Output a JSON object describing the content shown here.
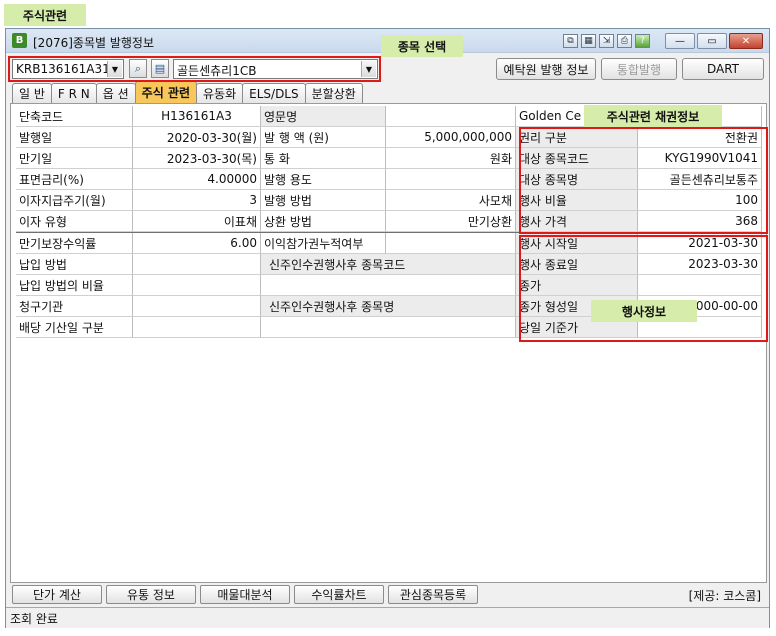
{
  "annotations": {
    "top_label": "주식관련",
    "stock_select": "종목 선택",
    "bond_info": "주식관련 채권정보",
    "exercise_info": "행사정보"
  },
  "window": {
    "title": "[2076]종목별 발행정보",
    "icon_letter": "B"
  },
  "toolbar": {
    "code_value": "KRB136161A31",
    "name_value": "골든센츄리1CB",
    "depository_button": "예탁원 발행 정보",
    "integrated_button": "통합발행",
    "dart_button": "DART"
  },
  "tabs": [
    {
      "label": "일  반"
    },
    {
      "label": "F R N"
    },
    {
      "label": "옵  션"
    },
    {
      "label": "주식 관련"
    },
    {
      "label": "유동화"
    },
    {
      "label": "ELS/DLS"
    },
    {
      "label": "분할상환"
    }
  ],
  "left_table": [
    {
      "label": "단축코드",
      "value": "H136161A3"
    },
    {
      "label": "발행일",
      "value": "2020-03-30(월)"
    },
    {
      "label": "만기일",
      "value": "2023-03-30(목)"
    },
    {
      "label": "표면금리(%)",
      "value": "4.00000"
    },
    {
      "label": "이자지급주기(월)",
      "value": "3"
    },
    {
      "label": "이자 유형",
      "value": "이표채"
    }
  ],
  "middle_table": [
    {
      "label": "영문명",
      "value": "Golden Ce"
    },
    {
      "label": "발 행 액 (원)",
      "value": "5,000,000,000"
    },
    {
      "label": "통  화",
      "value": "원화"
    },
    {
      "label": "발행 용도",
      "value": ""
    },
    {
      "label": "발행 방법",
      "value": "사모채"
    },
    {
      "label": "상환 방법",
      "value": "만기상환"
    }
  ],
  "bond_table": [
    {
      "label": "권리 구분",
      "value": "전환권"
    },
    {
      "label": "대상 종목코드",
      "value": "KYG1990V1041"
    },
    {
      "label": "대상 종목명",
      "value": "골든센츄리보통주"
    },
    {
      "label": "행사 비율",
      "value": "100"
    },
    {
      "label": "행사 가격",
      "value": "368"
    }
  ],
  "lower_left": [
    {
      "label": "만기보장수익률",
      "value": "6.00"
    },
    {
      "label": "납입 방법",
      "value": ""
    },
    {
      "label": "납입 방법의 비율",
      "value": ""
    },
    {
      "label": "청구기관",
      "value": ""
    },
    {
      "label": "배당 기산일 구분",
      "value": ""
    }
  ],
  "lower_middle": [
    {
      "label": "이익참가권누적여부",
      "value": ""
    },
    {
      "label": "신주인수권행사후 종목코드",
      "value": ""
    },
    {
      "label": "",
      "value": ""
    },
    {
      "label": "신주인수권행사후 종목명",
      "value": ""
    },
    {
      "label": "",
      "value": ""
    }
  ],
  "exercise_table": [
    {
      "label": "행사 시작일",
      "value": "2021-03-30"
    },
    {
      "label": "행사 종료일",
      "value": "2023-03-30"
    },
    {
      "label": "종가",
      "value": ""
    },
    {
      "label": "종가 형성일",
      "value": "0000-00-00"
    },
    {
      "label": "당일 기준가",
      "value": ""
    }
  ],
  "bottom_buttons": [
    {
      "label": "단가 계산"
    },
    {
      "label": "유통 정보"
    },
    {
      "label": "매물대분석"
    },
    {
      "label": "수익률차트"
    },
    {
      "label": "관심종목등록"
    }
  ],
  "provider": "[제공: 코스콤]",
  "status": "조회 완료"
}
